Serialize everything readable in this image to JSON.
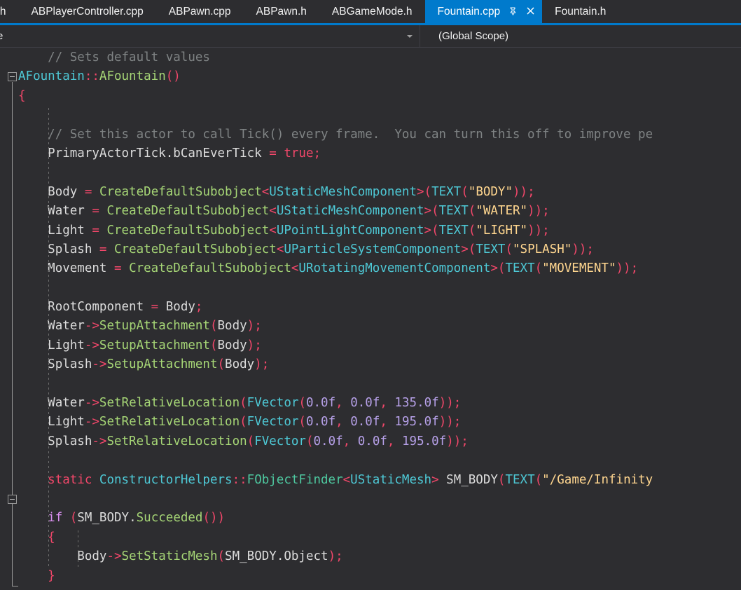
{
  "window": {
    "app": "Visual Studio",
    "theme_background": "#2d2d30",
    "accent": "#007acc"
  },
  "tabs": {
    "items": [
      {
        "label": "roller.h",
        "active": false,
        "truncated_left": true
      },
      {
        "label": "ABPlayerController.cpp",
        "active": false
      },
      {
        "label": "ABPawn.cpp",
        "active": false
      },
      {
        "label": "ABPawn.h",
        "active": false
      },
      {
        "label": "ABGameMode.h",
        "active": false
      },
      {
        "label": "Fountain.cpp",
        "active": true
      },
      {
        "label": "Fountain.h",
        "active": false,
        "truncated_right": true
      }
    ],
    "active_icons": {
      "pin": "pin-icon",
      "close": "close-icon"
    }
  },
  "navbar": {
    "left_combo_value": "e",
    "right_combo_value": "(Global Scope)",
    "dropdown_icon": "chevron-down-icon"
  },
  "editor": {
    "language": "C++",
    "fold_markers": [
      {
        "line_index": 1,
        "state": "expanded"
      },
      {
        "line_index": 23,
        "state": "expanded"
      }
    ],
    "lines": [
      {
        "indent": 1,
        "tokens": [
          {
            "t": "// Sets default values",
            "c": "cmt"
          }
        ]
      },
      {
        "indent": 0,
        "tokens": [
          {
            "t": "AFountain",
            "c": "type"
          },
          {
            "t": "::",
            "c": "punc"
          },
          {
            "t": "AFountain",
            "c": "func"
          },
          {
            "t": "()",
            "c": "punc"
          }
        ]
      },
      {
        "indent": 0,
        "tokens": [
          {
            "t": "{",
            "c": "punc"
          }
        ]
      },
      {
        "indent": 0,
        "tokens": []
      },
      {
        "indent": 1,
        "tokens": [
          {
            "t": "// Set this actor to call Tick() every frame.  You can turn this off to improve pe",
            "c": "cmt"
          }
        ]
      },
      {
        "indent": 1,
        "tokens": [
          {
            "t": "PrimaryActorTick",
            "c": "plain"
          },
          {
            "t": ".",
            "c": "plain"
          },
          {
            "t": "bCanEverTick ",
            "c": "plain"
          },
          {
            "t": "=",
            "c": "punc"
          },
          {
            "t": " ",
            "c": "plain"
          },
          {
            "t": "true",
            "c": "kw"
          },
          {
            "t": ";",
            "c": "punc"
          }
        ]
      },
      {
        "indent": 1,
        "tokens": []
      },
      {
        "indent": 1,
        "tokens": [
          {
            "t": "Body ",
            "c": "plain"
          },
          {
            "t": "=",
            "c": "punc"
          },
          {
            "t": " ",
            "c": "plain"
          },
          {
            "t": "CreateDefaultSubobject",
            "c": "func"
          },
          {
            "t": "<",
            "c": "punc"
          },
          {
            "t": "UStaticMeshComponent",
            "c": "type"
          },
          {
            "t": ">(",
            "c": "punc"
          },
          {
            "t": "TEXT",
            "c": "macro"
          },
          {
            "t": "(",
            "c": "punc"
          },
          {
            "t": "\"BODY\"",
            "c": "str"
          },
          {
            "t": "));",
            "c": "punc"
          }
        ]
      },
      {
        "indent": 1,
        "tokens": [
          {
            "t": "Water ",
            "c": "plain"
          },
          {
            "t": "=",
            "c": "punc"
          },
          {
            "t": " ",
            "c": "plain"
          },
          {
            "t": "CreateDefaultSubobject",
            "c": "func"
          },
          {
            "t": "<",
            "c": "punc"
          },
          {
            "t": "UStaticMeshComponent",
            "c": "type"
          },
          {
            "t": ">(",
            "c": "punc"
          },
          {
            "t": "TEXT",
            "c": "macro"
          },
          {
            "t": "(",
            "c": "punc"
          },
          {
            "t": "\"WATER\"",
            "c": "str"
          },
          {
            "t": "));",
            "c": "punc"
          }
        ]
      },
      {
        "indent": 1,
        "tokens": [
          {
            "t": "Light ",
            "c": "plain"
          },
          {
            "t": "=",
            "c": "punc"
          },
          {
            "t": " ",
            "c": "plain"
          },
          {
            "t": "CreateDefaultSubobject",
            "c": "func"
          },
          {
            "t": "<",
            "c": "punc"
          },
          {
            "t": "UPointLightComponent",
            "c": "type"
          },
          {
            "t": ">(",
            "c": "punc"
          },
          {
            "t": "TEXT",
            "c": "macro"
          },
          {
            "t": "(",
            "c": "punc"
          },
          {
            "t": "\"LIGHT\"",
            "c": "str"
          },
          {
            "t": "));",
            "c": "punc"
          }
        ]
      },
      {
        "indent": 1,
        "tokens": [
          {
            "t": "Splash ",
            "c": "plain"
          },
          {
            "t": "=",
            "c": "punc"
          },
          {
            "t": " ",
            "c": "plain"
          },
          {
            "t": "CreateDefaultSubobject",
            "c": "func"
          },
          {
            "t": "<",
            "c": "punc"
          },
          {
            "t": "UParticleSystemComponent",
            "c": "type"
          },
          {
            "t": ">(",
            "c": "punc"
          },
          {
            "t": "TEXT",
            "c": "macro"
          },
          {
            "t": "(",
            "c": "punc"
          },
          {
            "t": "\"SPLASH\"",
            "c": "str"
          },
          {
            "t": "));",
            "c": "punc"
          }
        ]
      },
      {
        "indent": 1,
        "tokens": [
          {
            "t": "Movement ",
            "c": "plain"
          },
          {
            "t": "=",
            "c": "punc"
          },
          {
            "t": " ",
            "c": "plain"
          },
          {
            "t": "CreateDefaultSubobject",
            "c": "func"
          },
          {
            "t": "<",
            "c": "punc"
          },
          {
            "t": "URotatingMovementComponent",
            "c": "type"
          },
          {
            "t": ">(",
            "c": "punc"
          },
          {
            "t": "TEXT",
            "c": "macro"
          },
          {
            "t": "(",
            "c": "punc"
          },
          {
            "t": "\"MOVEMENT\"",
            "c": "str"
          },
          {
            "t": "));",
            "c": "punc"
          }
        ]
      },
      {
        "indent": 1,
        "tokens": []
      },
      {
        "indent": 1,
        "tokens": [
          {
            "t": "RootComponent ",
            "c": "plain"
          },
          {
            "t": "=",
            "c": "punc"
          },
          {
            "t": " Body",
            "c": "plain"
          },
          {
            "t": ";",
            "c": "punc"
          }
        ]
      },
      {
        "indent": 1,
        "tokens": [
          {
            "t": "Water",
            "c": "plain"
          },
          {
            "t": "->",
            "c": "punc"
          },
          {
            "t": "SetupAttachment",
            "c": "func"
          },
          {
            "t": "(",
            "c": "punc"
          },
          {
            "t": "Body",
            "c": "plain"
          },
          {
            "t": ");",
            "c": "punc"
          }
        ]
      },
      {
        "indent": 1,
        "tokens": [
          {
            "t": "Light",
            "c": "plain"
          },
          {
            "t": "->",
            "c": "punc"
          },
          {
            "t": "SetupAttachment",
            "c": "func"
          },
          {
            "t": "(",
            "c": "punc"
          },
          {
            "t": "Body",
            "c": "plain"
          },
          {
            "t": ");",
            "c": "punc"
          }
        ]
      },
      {
        "indent": 1,
        "tokens": [
          {
            "t": "Splash",
            "c": "plain"
          },
          {
            "t": "->",
            "c": "punc"
          },
          {
            "t": "SetupAttachment",
            "c": "func"
          },
          {
            "t": "(",
            "c": "punc"
          },
          {
            "t": "Body",
            "c": "plain"
          },
          {
            "t": ");",
            "c": "punc"
          }
        ]
      },
      {
        "indent": 1,
        "tokens": []
      },
      {
        "indent": 1,
        "tokens": [
          {
            "t": "Water",
            "c": "plain"
          },
          {
            "t": "->",
            "c": "punc"
          },
          {
            "t": "SetRelativeLocation",
            "c": "func"
          },
          {
            "t": "(",
            "c": "punc"
          },
          {
            "t": "FVector",
            "c": "type"
          },
          {
            "t": "(",
            "c": "punc"
          },
          {
            "t": "0.0f",
            "c": "num"
          },
          {
            "t": ",",
            "c": "punc"
          },
          {
            "t": " ",
            "c": "plain"
          },
          {
            "t": "0.0f",
            "c": "num"
          },
          {
            "t": ",",
            "c": "punc"
          },
          {
            "t": " ",
            "c": "plain"
          },
          {
            "t": "135.0f",
            "c": "num"
          },
          {
            "t": "));",
            "c": "punc"
          }
        ]
      },
      {
        "indent": 1,
        "tokens": [
          {
            "t": "Light",
            "c": "plain"
          },
          {
            "t": "->",
            "c": "punc"
          },
          {
            "t": "SetRelativeLocation",
            "c": "func"
          },
          {
            "t": "(",
            "c": "punc"
          },
          {
            "t": "FVector",
            "c": "type"
          },
          {
            "t": "(",
            "c": "punc"
          },
          {
            "t": "0.0f",
            "c": "num"
          },
          {
            "t": ",",
            "c": "punc"
          },
          {
            "t": " ",
            "c": "plain"
          },
          {
            "t": "0.0f",
            "c": "num"
          },
          {
            "t": ",",
            "c": "punc"
          },
          {
            "t": " ",
            "c": "plain"
          },
          {
            "t": "195.0f",
            "c": "num"
          },
          {
            "t": "));",
            "c": "punc"
          }
        ]
      },
      {
        "indent": 1,
        "tokens": [
          {
            "t": "Splash",
            "c": "plain"
          },
          {
            "t": "->",
            "c": "punc"
          },
          {
            "t": "SetRelativeLocation",
            "c": "func"
          },
          {
            "t": "(",
            "c": "punc"
          },
          {
            "t": "FVector",
            "c": "type"
          },
          {
            "t": "(",
            "c": "punc"
          },
          {
            "t": "0.0f",
            "c": "num"
          },
          {
            "t": ",",
            "c": "punc"
          },
          {
            "t": " ",
            "c": "plain"
          },
          {
            "t": "0.0f",
            "c": "num"
          },
          {
            "t": ",",
            "c": "punc"
          },
          {
            "t": " ",
            "c": "plain"
          },
          {
            "t": "195.0f",
            "c": "num"
          },
          {
            "t": "));",
            "c": "punc"
          }
        ]
      },
      {
        "indent": 1,
        "tokens": []
      },
      {
        "indent": 1,
        "tokens": [
          {
            "t": "static",
            "c": "kw"
          },
          {
            "t": " ",
            "c": "plain"
          },
          {
            "t": "ConstructorHelpers",
            "c": "type"
          },
          {
            "t": "::",
            "c": "punc"
          },
          {
            "t": "FObjectFinder",
            "c": "tmpl"
          },
          {
            "t": "<",
            "c": "punc"
          },
          {
            "t": "UStaticMesh",
            "c": "type"
          },
          {
            "t": ">",
            "c": "punc"
          },
          {
            "t": " SM_BODY",
            "c": "plain"
          },
          {
            "t": "(",
            "c": "punc"
          },
          {
            "t": "TEXT",
            "c": "macro"
          },
          {
            "t": "(",
            "c": "punc"
          },
          {
            "t": "\"/Game/Infinity",
            "c": "str"
          }
        ]
      },
      {
        "indent": 1,
        "tokens": []
      },
      {
        "indent": 1,
        "tokens": [
          {
            "t": "if",
            "c": "kw2"
          },
          {
            "t": " ",
            "c": "plain"
          },
          {
            "t": "(",
            "c": "punc"
          },
          {
            "t": "SM_BODY",
            "c": "plain"
          },
          {
            "t": ".",
            "c": "plain"
          },
          {
            "t": "Succeeded",
            "c": "func"
          },
          {
            "t": "())",
            "c": "punc"
          }
        ]
      },
      {
        "indent": 1,
        "tokens": [
          {
            "t": "{",
            "c": "punc"
          }
        ]
      },
      {
        "indent": 2,
        "tokens": [
          {
            "t": "Body",
            "c": "plain"
          },
          {
            "t": "->",
            "c": "punc"
          },
          {
            "t": "SetStaticMesh",
            "c": "func"
          },
          {
            "t": "(",
            "c": "punc"
          },
          {
            "t": "SM_BODY",
            "c": "plain"
          },
          {
            "t": ".",
            "c": "plain"
          },
          {
            "t": "Object",
            "c": "plain"
          },
          {
            "t": ");",
            "c": "punc"
          }
        ]
      },
      {
        "indent": 1,
        "tokens": [
          {
            "t": "}",
            "c": "punc"
          }
        ]
      }
    ]
  }
}
